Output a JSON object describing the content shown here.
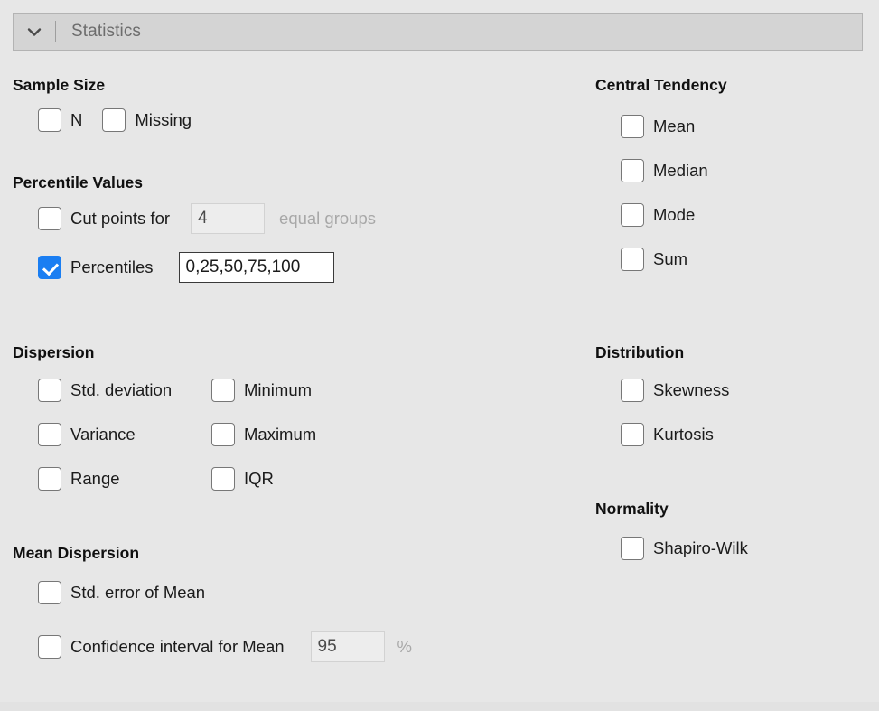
{
  "header": {
    "title": "Statistics",
    "collapse_icon": "chevron-down-icon"
  },
  "left_column": {
    "sample_size": {
      "title": "Sample Size",
      "items": [
        {
          "label": "N",
          "checked": false
        },
        {
          "label": "Missing",
          "checked": false
        }
      ]
    },
    "percentile_values": {
      "title": "Percentile Values",
      "cut_points": {
        "label": "Cut points for",
        "checked": false,
        "value": "4",
        "suffix": "equal groups",
        "enabled": false
      },
      "percentiles": {
        "label": "Percentiles",
        "checked": true,
        "value": "0,25,50,75,100",
        "enabled": true
      }
    },
    "dispersion": {
      "title": "Dispersion",
      "column_a": [
        {
          "label": "Std. deviation",
          "checked": false
        },
        {
          "label": "Variance",
          "checked": false
        },
        {
          "label": "Range",
          "checked": false
        }
      ],
      "column_b": [
        {
          "label": "Minimum",
          "checked": false
        },
        {
          "label": "Maximum",
          "checked": false
        },
        {
          "label": "IQR",
          "checked": false
        }
      ]
    },
    "mean_dispersion": {
      "title": "Mean Dispersion",
      "std_error": {
        "label": "Std. error of Mean",
        "checked": false
      },
      "confidence_interval": {
        "label": "Confidence interval for Mean",
        "checked": false,
        "value": "95",
        "suffix": "%",
        "enabled": false
      }
    }
  },
  "right_column": {
    "central_tendency": {
      "title": "Central Tendency",
      "items": [
        {
          "label": "Mean",
          "checked": false
        },
        {
          "label": "Median",
          "checked": false
        },
        {
          "label": "Mode",
          "checked": false
        },
        {
          "label": "Sum",
          "checked": false
        }
      ]
    },
    "distribution": {
      "title": "Distribution",
      "items": [
        {
          "label": "Skewness",
          "checked": false
        },
        {
          "label": "Kurtosis",
          "checked": false
        }
      ]
    },
    "normality": {
      "title": "Normality",
      "items": [
        {
          "label": "Shapiro-Wilk",
          "checked": false
        }
      ]
    }
  },
  "colors": {
    "panel_background": "#e7e7e7",
    "header_background": "#d4d4d4",
    "accent_checked": "#1a7ef2",
    "disabled_text": "#a8a8a8"
  }
}
